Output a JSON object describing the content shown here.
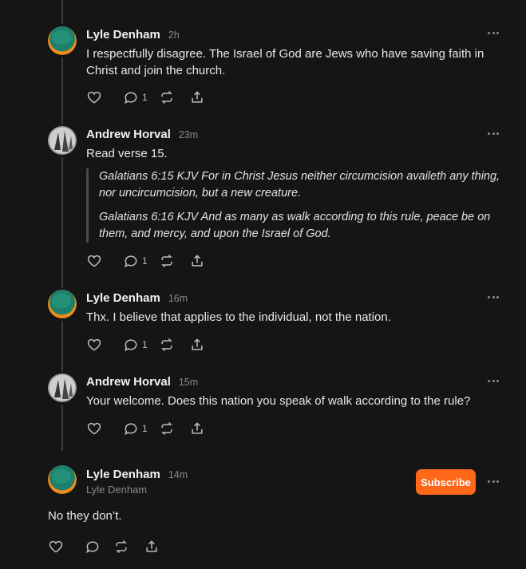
{
  "comments": [
    {
      "name": "Lyle Denham",
      "time": "2h",
      "avatar": "lyle",
      "text": "I respectfully disagree. The Israel of God are Jews who have saving faith in Christ and join the church.",
      "reply_count": "1"
    },
    {
      "name": "Andrew Horval",
      "time": "23m",
      "avatar": "andrew",
      "text": "Read verse 15.",
      "quotes": [
        "Galatians 6:15 KJV  For in Christ Jesus neither circumcision availeth any thing, nor uncircumcision, but a new creature.",
        "Galatians 6:16 KJV  And as many as walk according to this rule, peace be on them, and mercy, and upon the Israel of God."
      ],
      "reply_count": "1"
    },
    {
      "name": "Lyle Denham",
      "time": "16m",
      "avatar": "lyle",
      "text": "Thx. I believe that applies to the individual, not the nation.",
      "reply_count": "1"
    },
    {
      "name": "Andrew Horval",
      "time": "15m",
      "avatar": "andrew",
      "text": "Your welcome. Does this nation you speak of walk according to the rule?",
      "reply_count": "1"
    }
  ],
  "main_post": {
    "name": "Lyle Denham",
    "time": "14m",
    "handle": "Lyle Denham",
    "text": "No they don’t.",
    "subscribe_label": "Subscribe"
  },
  "colors": {
    "background": "#151515",
    "accent": "#ff6719",
    "muted": "#8a8a8a"
  },
  "icons": [
    "heart-icon",
    "comment-icon",
    "restack-icon",
    "share-icon",
    "more-icon"
  ]
}
